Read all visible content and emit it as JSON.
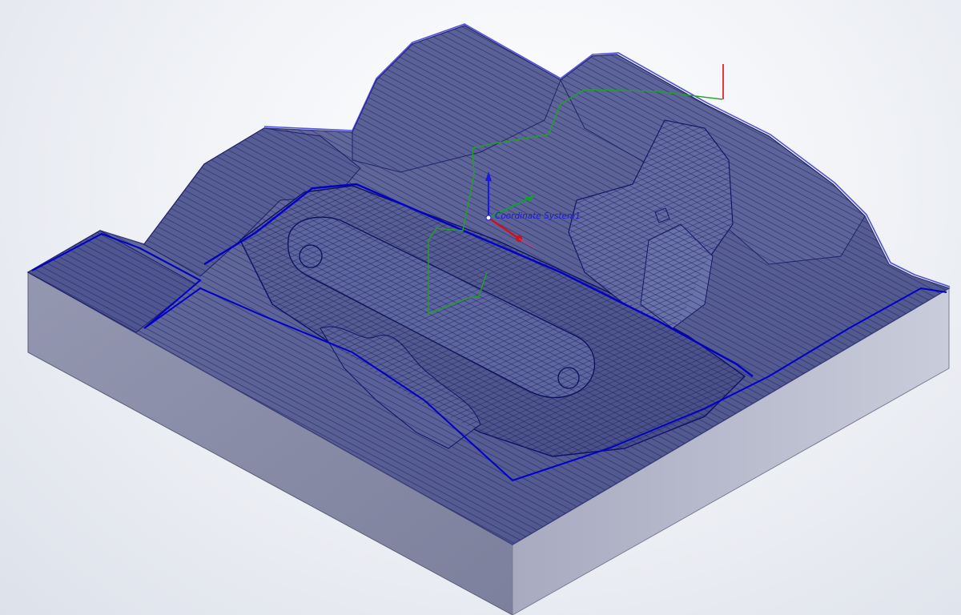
{
  "viewport": {
    "coordinate_system_label": "Coordinate System1"
  },
  "colors": {
    "background": "#eef0f5",
    "stock_top": "#7e84a8",
    "stock_left_side": "#888ba4",
    "stock_right_side": "#c0c3d3",
    "cavity_fill": "#545c93",
    "cavity_fill_light": "#6e76a8",
    "toolpath_lines": "#14146e",
    "toolpath_boundary": "#0000c8",
    "z_axis": "#1a1adc",
    "x_axis": "#d0101a",
    "y_axis": "#10a030",
    "rapid_move": "#1fa31f",
    "plunge_move": "#d81010"
  },
  "icons": [
    "coordinate-triad-icon"
  ]
}
